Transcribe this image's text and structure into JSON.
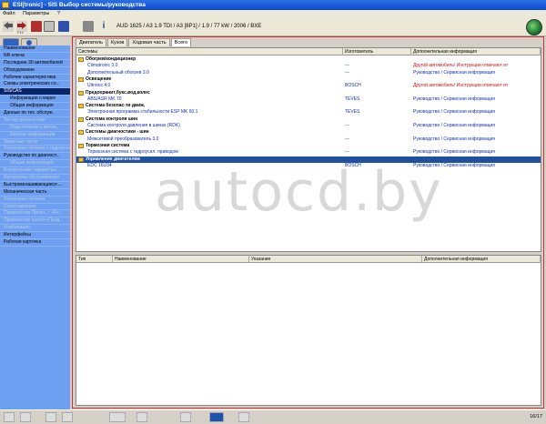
{
  "window": {
    "title": "ESI[tronic] - SIS Выбор системы/руководства"
  },
  "menu": [
    "Файл",
    "Параметры",
    "?"
  ],
  "toolbar": {
    "vehicle": "AUD 1625 / A3 1.9 TDI / A3 [8P1] / 1.9 / 77 kW / 2006 / BXE",
    "f12_label": "F12",
    "icons": [
      "back-icon",
      "forward-icon",
      "system-icon",
      "calculator-icon",
      "save-icon",
      "print-icon",
      "info-icon"
    ]
  },
  "sidebar": {
    "items": [
      {
        "label": "Наименование",
        "state": "normal"
      },
      {
        "label": "NR ключа",
        "state": "normal"
      },
      {
        "label": "Последние 30 автомобилей",
        "state": "normal"
      },
      {
        "label": "Оборудование",
        "state": "normal"
      },
      {
        "label": "Рабочие характеристики",
        "state": "normal"
      },
      {
        "label": "Схемы электрических со...",
        "state": "normal"
      },
      {
        "label": "SIS/CAS",
        "state": "selected"
      },
      {
        "label": "Информация о марке",
        "state": "indent"
      },
      {
        "label": "Общая информация",
        "state": "indent"
      },
      {
        "label": "Данные по тех. обслуж.",
        "state": "normal"
      },
      {
        "label": "Тестер диагностики",
        "state": "disabled"
      },
      {
        "label": "Подключение к автом...",
        "state": "disabled-indent"
      },
      {
        "label": "Каталог информации",
        "state": "disabled-indent"
      },
      {
        "label": "Запасные части",
        "state": "disabled"
      },
      {
        "label": "Тормозная система с гидроусил.",
        "state": "disabled"
      },
      {
        "label": "Руководство по диагност...",
        "state": "normal"
      },
      {
        "label": "Общая информация",
        "state": "disabled-indent"
      },
      {
        "label": "Контрольные параметры ...",
        "state": "disabled"
      },
      {
        "label": "Интервалы обслуживания",
        "state": "disabled"
      },
      {
        "label": "Быстроизнашивающиеся ...",
        "state": "normal"
      },
      {
        "label": "Механическая часть",
        "state": "normal"
      },
      {
        "label": "Тормозная система",
        "state": "disabled"
      },
      {
        "label": "Сопоставление",
        "state": "disabled"
      },
      {
        "label": "Применение Просп. > «Кн...",
        "state": "disabled"
      },
      {
        "label": "Применение части>«Прод...",
        "state": "disabled"
      },
      {
        "label": "Комбинации",
        "state": "disabled"
      },
      {
        "label": "Интерфейсы",
        "state": "normal"
      },
      {
        "label": "Рабочая карточка",
        "state": "normal"
      }
    ]
  },
  "tabs": [
    "Двигатель",
    "Кузов",
    "Ходовая часть",
    "Всего"
  ],
  "active_tab": 3,
  "upper_table": {
    "headers": [
      "Системы",
      "Изготовитель",
      "Дополнительная информация"
    ],
    "rows": [
      {
        "type": "grp",
        "c1": "Обогрев/кондиционер",
        "c2": "",
        "c3": ""
      },
      {
        "type": "sub",
        "c1": "Climatronic 3.0",
        "c2": "---",
        "c3": "Другой автомобиль! Инструкции отвечают ит",
        "color": "red"
      },
      {
        "type": "sub",
        "c1": "Дополнительный обогрев 3.0",
        "c2": "---",
        "c3": "Руководство / Сервисная информация",
        "color": "blue"
      },
      {
        "type": "grp",
        "c1": "Освещение",
        "c2": "",
        "c3": ""
      },
      {
        "type": "sub",
        "c1": "Ultronic 4.0",
        "c2": "BOSCH",
        "c3": "Другой автомобиль! Инструкции отвечают ит",
        "color": "red"
      },
      {
        "type": "grp",
        "c1": "Предохранит,букс.вод,колес",
        "c2": "",
        "c3": ""
      },
      {
        "type": "sub",
        "c1": "ABS/ASR MK 70",
        "c2": "TEVES",
        "c3": "Руководство / Сервисная информация",
        "color": "blue"
      },
      {
        "type": "grp",
        "c1": "Система безопас-ти движ.",
        "c2": "",
        "c3": ""
      },
      {
        "type": "sub",
        "c1": "Электронная программа стабильности ESP MK 60.1",
        "c2": "TEVES",
        "c3": "Руководство / Сервисная информация",
        "color": "blue"
      },
      {
        "type": "grp",
        "c1": "Система контроля шин",
        "c2": "",
        "c3": ""
      },
      {
        "type": "sub",
        "c1": "Система контроля давления в шинах (RDK)",
        "c2": "---",
        "c3": "Руководство / Сервисная информация",
        "color": "blue"
      },
      {
        "type": "grp",
        "c1": "Системы диагностики - шин",
        "c2": "",
        "c3": ""
      },
      {
        "type": "sub",
        "c1": "Межсетевой преобразователь 3.0",
        "c2": "---",
        "c3": "Руководство / Сервисная информация",
        "color": "blue"
      },
      {
        "type": "grp",
        "c1": "Тормозная система",
        "c2": "",
        "c3": ""
      },
      {
        "type": "sub",
        "c1": "Тормозная система с гидроусил. приводом",
        "c2": "---",
        "c3": "Руководство / Сервисная информация",
        "color": "blue"
      },
      {
        "type": "sel",
        "c1": "Управление двигателем",
        "c2": "",
        "c3": ""
      },
      {
        "type": "sub",
        "c1": "EDC 16U34",
        "c2": "BOSCH",
        "c3": "Руководство / Сервисная информация",
        "color": "blue"
      }
    ]
  },
  "lower_table": {
    "headers": [
      "Тип",
      "Наименование",
      "Указание",
      "Дополнительная информация"
    ]
  },
  "watermark": "autocd.by",
  "status": {
    "page": "16/17"
  }
}
